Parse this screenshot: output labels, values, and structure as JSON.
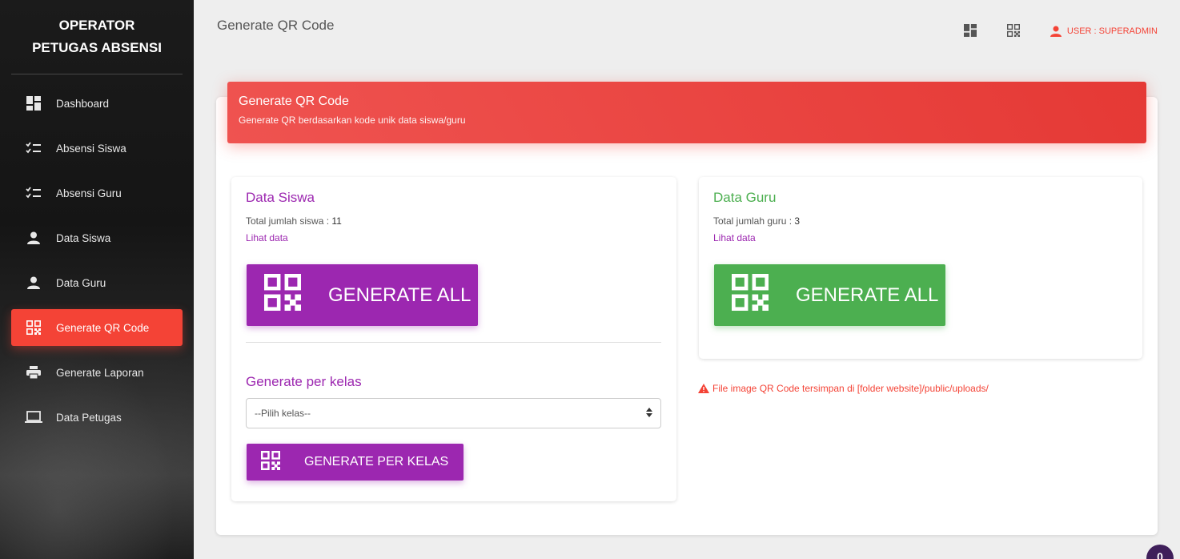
{
  "sidebar": {
    "brand_line1": "OPERATOR",
    "brand_line2": "PETUGAS ABSENSI",
    "items": [
      {
        "label": "Dashboard",
        "icon": "dashboard-icon"
      },
      {
        "label": "Absensi Siswa",
        "icon": "checklist-icon"
      },
      {
        "label": "Absensi Guru",
        "icon": "checklist-icon"
      },
      {
        "label": "Data Siswa",
        "icon": "person-icon"
      },
      {
        "label": "Data Guru",
        "icon": "person-icon"
      },
      {
        "label": "Generate QR Code",
        "icon": "qr-code-icon",
        "active": true
      },
      {
        "label": "Generate Laporan",
        "icon": "print-icon"
      },
      {
        "label": "Data Petugas",
        "icon": "computer-icon"
      }
    ]
  },
  "topbar": {
    "title": "Generate QR Code",
    "user_label": "USER : SUPERADMIN"
  },
  "header": {
    "title": "Generate QR Code",
    "subtitle": "Generate QR berdasarkan kode unik data siswa/guru"
  },
  "siswa": {
    "title": "Data Siswa",
    "count_label": "Total jumlah siswa : ",
    "count": "11",
    "link": "Lihat data",
    "generate_all": "GENERATE ALL",
    "per_kelas_title": "Generate per kelas",
    "select_placeholder": "--Pilih kelas--",
    "generate_per_kelas": "GENERATE PER KELAS"
  },
  "guru": {
    "title": "Data Guru",
    "count_label": "Total jumlah guru : ",
    "count": "3",
    "link": "Lihat data",
    "generate_all": "GENERATE ALL"
  },
  "warning": "File image QR Code tersimpan di [folder website]/public/uploads/",
  "fab_label": "0",
  "colors": {
    "primary": "#9c27b0",
    "success": "#4caf50",
    "danger": "#f44336"
  }
}
